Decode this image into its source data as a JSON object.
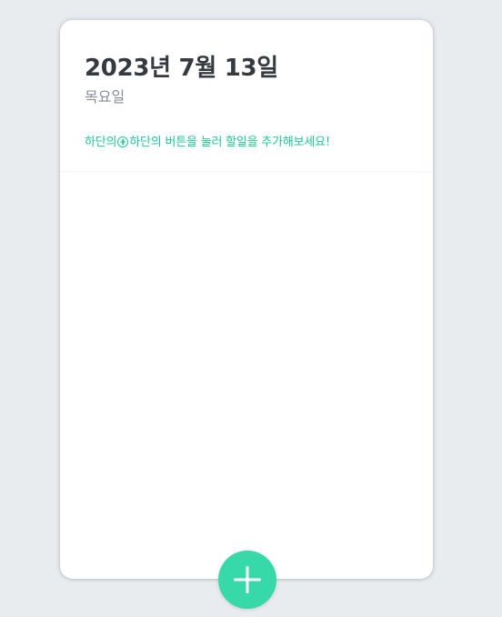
{
  "header": {
    "date": "2023년 7월 13일",
    "weekday": "목요일",
    "hint_before": "하단의",
    "hint_after": "하단의 버튼을 눌러 할일을 추가해보세요!"
  },
  "todos": [],
  "colors": {
    "background": "#e9ecef",
    "card": "#ffffff",
    "accent": "#38d9a9",
    "hint_text": "#20c997",
    "title_text": "#343a40",
    "weekday_text": "#868e96"
  },
  "icons": {
    "hint_icon": "plus-circle-icon",
    "add_button_icon": "plus-icon"
  }
}
